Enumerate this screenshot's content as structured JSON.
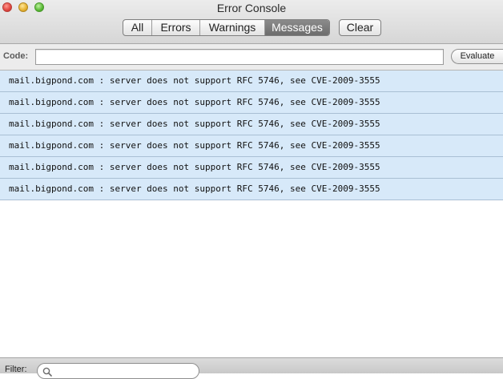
{
  "window": {
    "title": "Error Console"
  },
  "toolbar": {
    "filters": [
      {
        "label": "All",
        "selected": false
      },
      {
        "label": "Errors",
        "selected": false
      },
      {
        "label": "Warnings",
        "selected": false
      },
      {
        "label": "Messages",
        "selected": true
      }
    ],
    "clear_label": "Clear"
  },
  "codebar": {
    "label": "Code:",
    "value": "",
    "evaluate_label": "Evaluate"
  },
  "messages": [
    "mail.bigpond.com : server does not support RFC 5746, see CVE-2009-3555",
    "mail.bigpond.com : server does not support RFC 5746, see CVE-2009-3555",
    "mail.bigpond.com : server does not support RFC 5746, see CVE-2009-3555",
    "mail.bigpond.com : server does not support RFC 5746, see CVE-2009-3555",
    "mail.bigpond.com : server does not support RFC 5746, see CVE-2009-3555",
    "mail.bigpond.com : server does not support RFC 5746, see CVE-2009-3555"
  ],
  "filterbar": {
    "label": "Filter:",
    "value": "",
    "icon": "search-icon"
  },
  "colors": {
    "message_row_bg": "#d7e9f9",
    "selected_segment_bg": "#7a7a7a"
  }
}
